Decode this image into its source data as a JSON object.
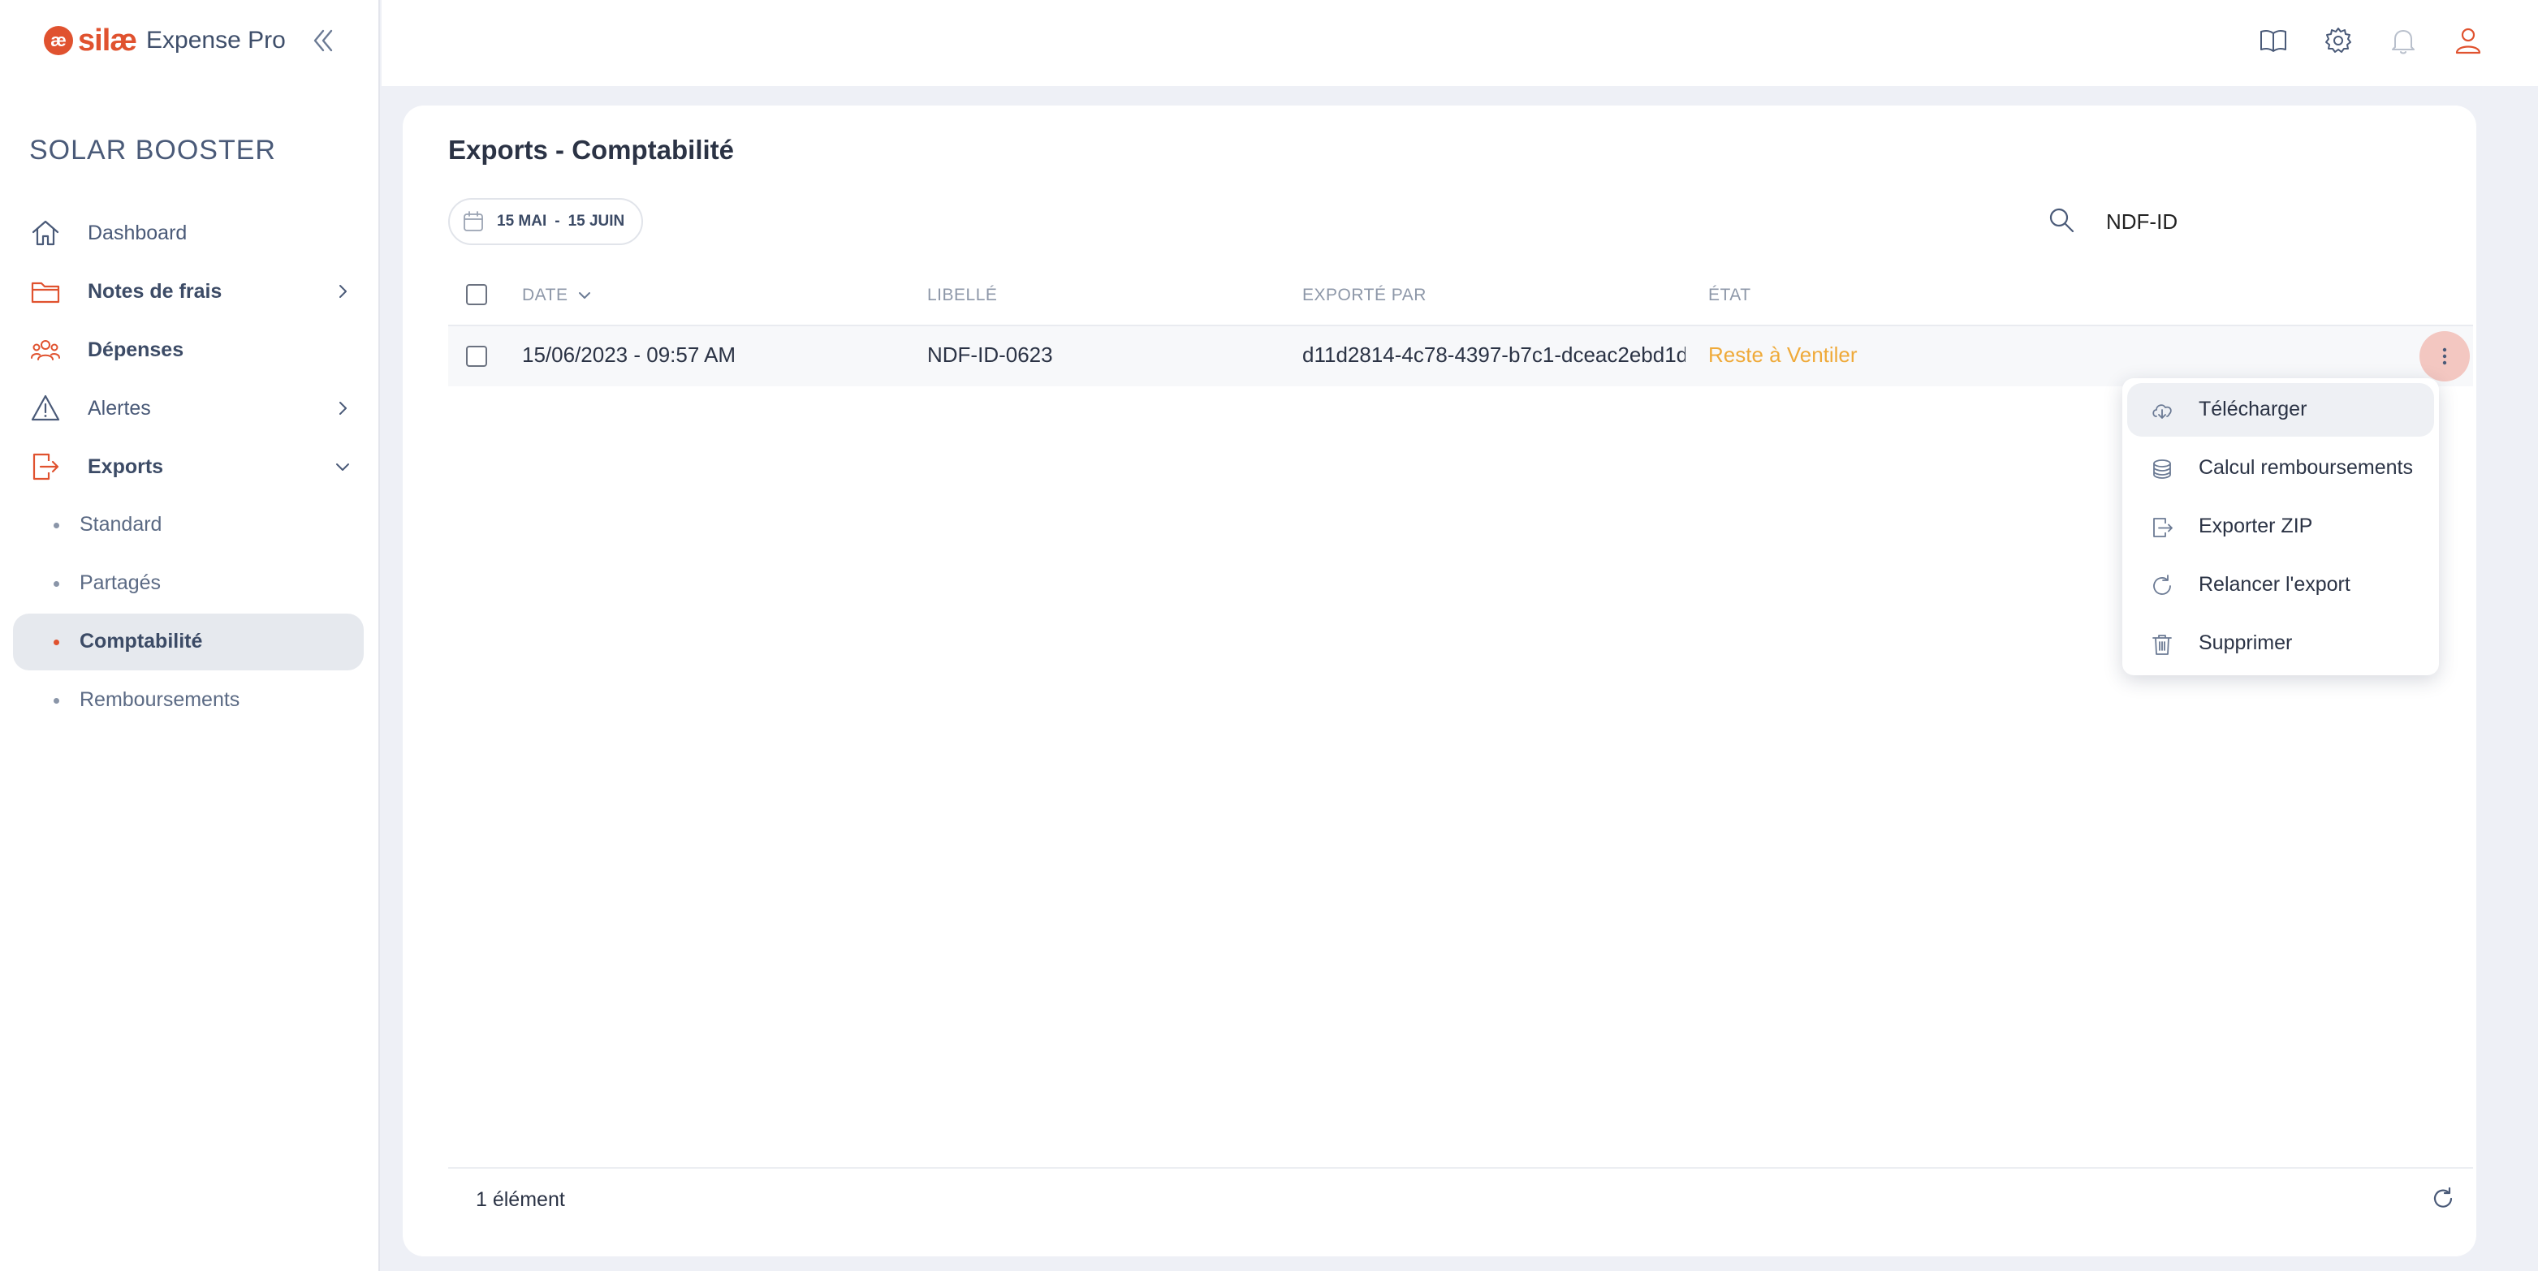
{
  "brand": {
    "mark": "æ",
    "name": "silæ",
    "product": "Expense Pro"
  },
  "sidebar": {
    "org_name": "SOLAR BOOSTER",
    "items": [
      {
        "label": "Dashboard",
        "icon": "home-icon"
      },
      {
        "label": "Notes de frais",
        "icon": "folder-icon"
      },
      {
        "label": "Dépenses",
        "icon": "users-icon"
      },
      {
        "label": "Alertes",
        "icon": "warning-icon"
      },
      {
        "label": "Exports",
        "icon": "export-icon"
      }
    ],
    "export_subitems": [
      {
        "label": "Standard"
      },
      {
        "label": "Partagés"
      },
      {
        "label": "Comptabilité",
        "active": true
      },
      {
        "label": "Remboursements"
      }
    ]
  },
  "topbar": {
    "icons": [
      "book-icon",
      "gear-icon",
      "bell-icon",
      "user-icon"
    ]
  },
  "main": {
    "title": "Exports - Comptabilité",
    "date_range": {
      "start": "15 MAI",
      "separator": "-",
      "end": "15 JUIN"
    },
    "search": {
      "value": "NDF-ID"
    },
    "table": {
      "columns": [
        "DATE",
        "LIBELLÉ",
        "EXPORTÉ PAR",
        "ÉTAT"
      ],
      "rows": [
        {
          "date": "15/06/2023 - 09:57 AM",
          "label": "NDF-ID-0623",
          "exported_by": "d11d2814-4c78-4397-b7c1-dceac2ebd1d",
          "state": "Reste à Ventiler"
        }
      ]
    },
    "row_menu": {
      "items": [
        {
          "label": "Télécharger",
          "icon": "cloud-download-icon"
        },
        {
          "label": "Calcul remboursements",
          "icon": "coins-icon"
        },
        {
          "label": "Exporter ZIP",
          "icon": "file-export-icon"
        },
        {
          "label": "Relancer l'export",
          "icon": "retry-icon"
        },
        {
          "label": "Supprimer",
          "icon": "trash-icon"
        }
      ]
    },
    "footer": {
      "count": "1 élément"
    }
  },
  "colors": {
    "accent": "#e0522f",
    "state_warning": "#efaa3a",
    "nav_text": "#4a5a78",
    "background": "#eef0f6"
  }
}
